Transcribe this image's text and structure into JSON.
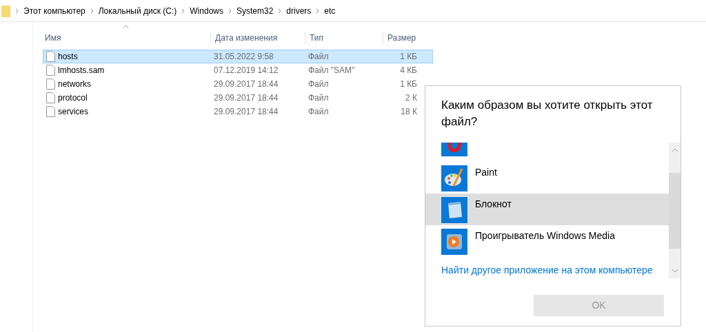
{
  "breadcrumb": [
    "Этот компьютер",
    "Локальный диск (C:)",
    "Windows",
    "System32",
    "drivers",
    "etc"
  ],
  "columns": [
    "Имя",
    "Дата изменения",
    "Тип",
    "Размер"
  ],
  "files": [
    {
      "name": "hosts",
      "date": "31.05.2022 9:58",
      "type": "Файл",
      "size": "1 КБ",
      "selected": true
    },
    {
      "name": "lmhosts.sam",
      "date": "07.12.2019 14:12",
      "type": "Файл \"SAM\"",
      "size": "4 КБ",
      "selected": false
    },
    {
      "name": "networks",
      "date": "29.09.2017 18:44",
      "type": "Файл",
      "size": "1 КБ",
      "selected": false
    },
    {
      "name": "protocol",
      "date": "29.09.2017 18:44",
      "type": "Файл",
      "size": "2 К",
      "selected": false
    },
    {
      "name": "services",
      "date": "29.09.2017 18:44",
      "type": "Файл",
      "size": "18 К",
      "selected": false
    }
  ],
  "dialog": {
    "title": "Каким образом вы хотите открыть этот файл?",
    "apps": [
      {
        "kind": "cut",
        "selected": false
      },
      {
        "kind": "full",
        "label": "Paint",
        "selected": false
      },
      {
        "kind": "full",
        "label": "Блокнот",
        "selected": true
      },
      {
        "kind": "full",
        "label": "Проигрыватель Windows Media",
        "selected": false
      }
    ],
    "link": "Найти другое приложение на этом компьютере",
    "ok": {
      "label": "OK",
      "disabled": true
    }
  }
}
